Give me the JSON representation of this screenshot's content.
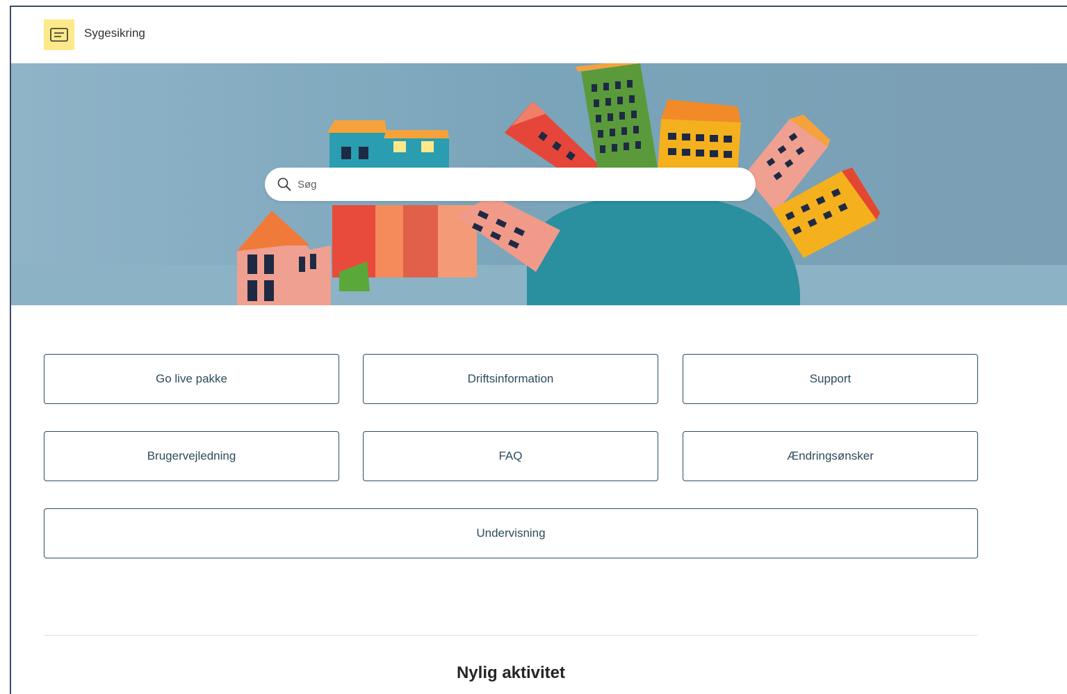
{
  "site": {
    "title": "Sygesikring",
    "logo_icon": "message-lines-icon",
    "logo_color": "#fde989"
  },
  "hero": {
    "image": "paper-craft-houses-illustration",
    "background_color": "#7fa8bd"
  },
  "search": {
    "placeholder": "Søg",
    "icon": "search-icon"
  },
  "quick_links": [
    {
      "label": "Go live pakke"
    },
    {
      "label": "Driftsinformation"
    },
    {
      "label": "Support"
    },
    {
      "label": "Brugervejledning"
    },
    {
      "label": "FAQ"
    },
    {
      "label": "Ændringsønsker"
    },
    {
      "label": "Undervisning"
    }
  ],
  "recent_activity": {
    "title": "Nylig aktivitet"
  },
  "colors": {
    "button_border": "#2d4b5d",
    "button_text": "#2d4b5d"
  }
}
